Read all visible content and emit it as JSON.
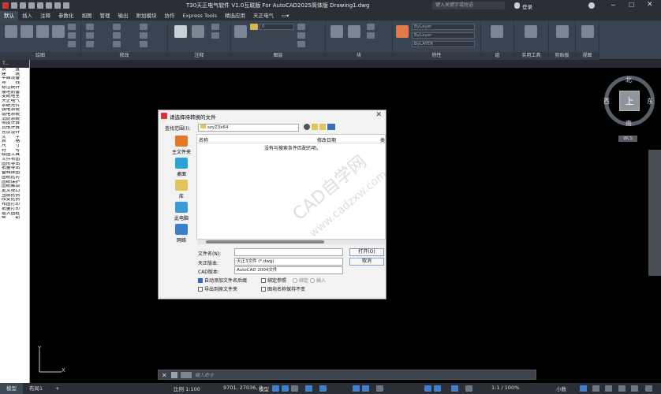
{
  "window": {
    "title": "T30天正电气软件 V1.0互联版 For AutoCAD2025简体版  Drawing1.dwg",
    "search_placeholder": "键入关键字或短语",
    "login": "登录"
  },
  "ribbon_tabs": [
    "默认",
    "插入",
    "注释",
    "参数化",
    "视图",
    "管理",
    "输出",
    "附加模块",
    "协作",
    "Express Tools",
    "精选应用",
    "天正电气",
    "▭▾"
  ],
  "ribbon_panels": [
    "绘图",
    "修改",
    "注释",
    "图层",
    "块",
    "特性",
    "组",
    "实用工具",
    "剪贴板",
    "视图"
  ],
  "layer_props": [
    "ByLayer",
    "ByLayer",
    "ByLAYER"
  ],
  "left_panel": {
    "header": "T...",
    "items": [
      "设　　置",
      "建　　筑",
      "平面设备",
      "导　　线",
      "标注统计",
      "接地防雷",
      "变配电室",
      "天正电气",
      "系统元件",
      "强电系统",
      "弱电系统",
      "消防系统",
      "照度计算",
      "其他计算",
      "光伏设计",
      "文　　字",
      "表　　格",
      "尺　　寸",
      "符　　号",
      "绘图工具",
      "文件布图",
      "图形导出",
      "批量导出",
      "备档拆图",
      "图纸比对",
      "图纸保护",
      "图纸解锁",
      "定义视口",
      "当前比例",
      "改变比例",
      "布图打印",
      "批量打印",
      "插入图框",
      "帮　　助"
    ]
  },
  "viewcube": {
    "north": "北",
    "south": "南",
    "west": "西",
    "east": "东",
    "face": "上",
    "wcs": "WCS"
  },
  "dialog": {
    "title": "请选择待转换的文件",
    "lookin_label": "查找范围(I):",
    "lookin_value": "szyZ3x64",
    "places": [
      "主文件夹",
      "桌面",
      "库",
      "此电脑",
      "网络"
    ],
    "columns": [
      "名称",
      "修改日期",
      "类"
    ],
    "empty_msg": "没有与搜索条件匹配的项。",
    "filename_label": "文件名(N):",
    "filename_value": "",
    "version_label": "天正版本:",
    "version_value": "天正3文件 (*.dwg)",
    "cad_label": "CAD版本:",
    "cad_value": "AutoCAD 2004文件",
    "open_btn": "打开(O)",
    "cancel_btn": "取消",
    "opt_auto_suffix": "自动添加文件名后缀",
    "opt_bind_ref": "绑定参照",
    "opt_bind": "绑定",
    "opt_insert": "插入",
    "opt_export_origin": "导出到原文件夹",
    "opt_keep_name": "图块名称保持不变",
    "watermark1": "CAD自学网",
    "watermark2": "www.cadzxw.com"
  },
  "command": {
    "placeholder": "键入命令"
  },
  "status": {
    "tabs": [
      "模型",
      "布局1"
    ],
    "scale": "比例 1:100",
    "coords": "9701, 27036, 0",
    "mode": "模型",
    "zoom": "1:1 / 100%",
    "size": "小数"
  }
}
